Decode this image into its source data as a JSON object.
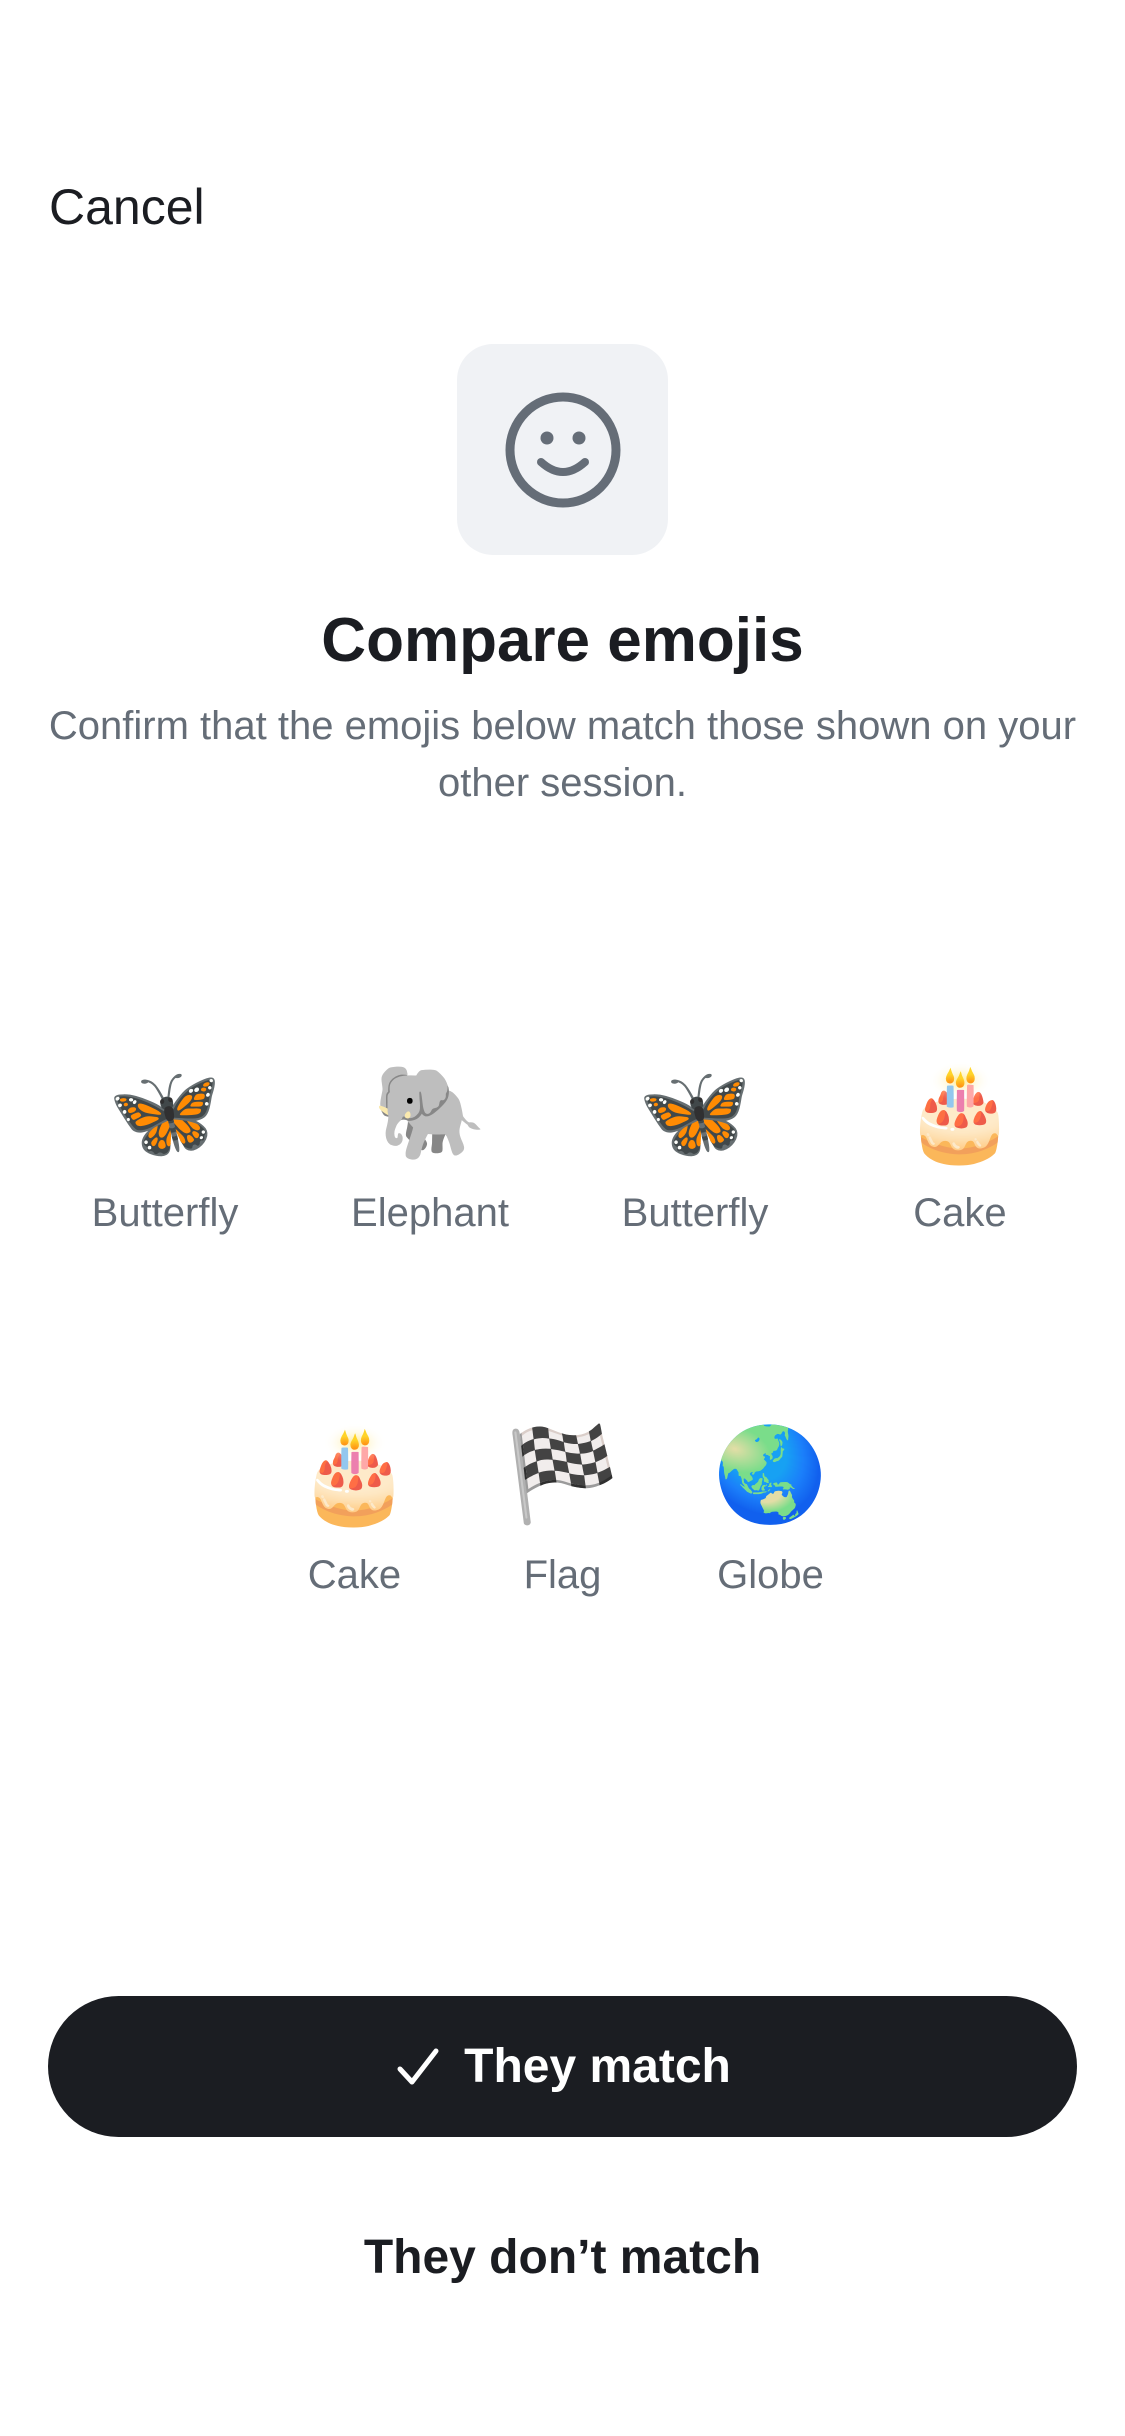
{
  "header": {
    "cancel_label": "Cancel"
  },
  "hero": {
    "icon": "smiley-face-icon",
    "title": "Compare emojis",
    "subtitle": "Confirm that the emojis below match those shown on your other session."
  },
  "emojis": [
    {
      "glyph": "🦋",
      "label": "Butterfly"
    },
    {
      "glyph": "🐘",
      "label": "Elephant"
    },
    {
      "glyph": "🦋",
      "label": "Butterfly"
    },
    {
      "glyph": "🎂",
      "label": "Cake"
    },
    {
      "glyph": "🎂",
      "label": "Cake"
    },
    {
      "glyph": "🏁",
      "label": "Flag"
    },
    {
      "glyph": "🌏",
      "label": "Globe"
    }
  ],
  "actions": {
    "match_label": "They match",
    "match_icon": "checkmark-icon",
    "no_match_label": "They don’t match"
  },
  "colors": {
    "primary_button": "#1b1d22",
    "icon_box_bg": "#f0f2f5",
    "secondary_text": "#656d77"
  }
}
